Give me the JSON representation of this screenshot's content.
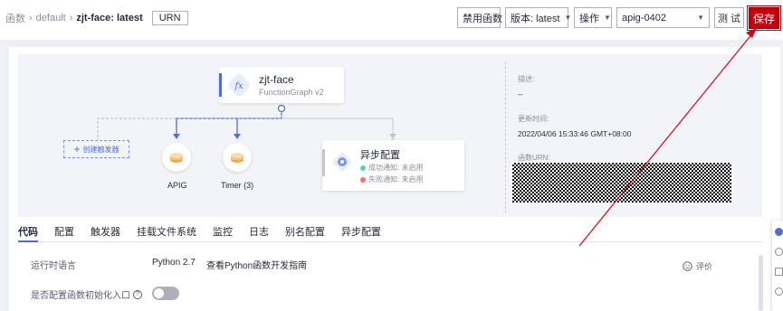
{
  "breadcrumb": {
    "root": "函数",
    "separator": "›",
    "middle": "default",
    "current": "zjt-face: latest",
    "urn_label": "URN"
  },
  "toolbar": {
    "disable_label": "禁用函数",
    "version_label": "版本: latest",
    "ops_label": "操作",
    "apig_select": "apig-0402",
    "test_label": "测 试",
    "save_label": "保存"
  },
  "graph": {
    "function_name": "zjt-face",
    "function_type": "FunctionGraph v2",
    "create_trigger": "创建触发器",
    "triggers": [
      {
        "label": "APIG",
        "icon": "apig-icon"
      },
      {
        "label": "Timer (3)",
        "icon": "timer-icon"
      }
    ],
    "async_config": {
      "title": "异步配置",
      "success": "成功通知: 未启用",
      "failure": "失败通知: 未启用",
      "success_color": "#50d4ab",
      "failure_color": "#f66f6a"
    }
  },
  "info": {
    "desc_label": "描述:",
    "desc_value": "--",
    "updated_label": "更新时间:",
    "updated_value": "2022/04/06 15:33:46 GMT+08:00",
    "urn_label": "函数URN:"
  },
  "tabs": [
    "代码",
    "配置",
    "触发器",
    "挂载文件系统",
    "监控",
    "日志",
    "别名配置",
    "异步配置"
  ],
  "code": {
    "runtime_label": "运行时语言",
    "runtime_value": "Python 2.7",
    "guide_link": "查看Python函数开发指南",
    "rate_label": "评价",
    "init_label": "是否配置函数初始化入口"
  },
  "colors": {
    "accent": "#526ecc",
    "save": "#c7000b",
    "annotation_arrow": "#e0000e"
  }
}
